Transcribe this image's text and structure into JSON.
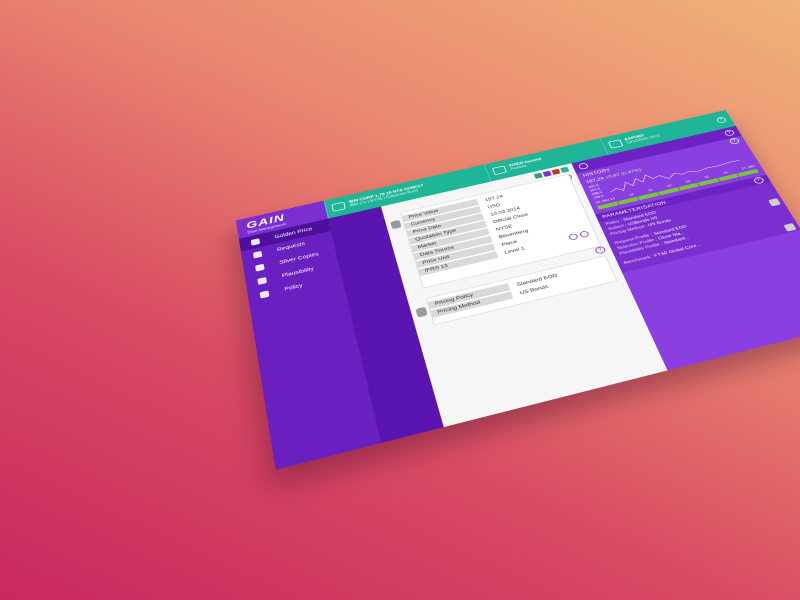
{
  "app": {
    "logo": "GAIN",
    "subtitle": "Data Management"
  },
  "topbar": {
    "instrument": {
      "title": "IBM CORP 1.75 18 NTS 02/06/17",
      "sub": "IBM 17s  |  NYSE  |  Corporate Bond"
    },
    "portfolio": {
      "title": "FIXED Income",
      "sub": "Portfolio"
    },
    "export": {
      "title": "EXPORT",
      "sub": "12/10/2015    18:02"
    }
  },
  "sidebar": {
    "items": [
      {
        "label": "Golden Price",
        "icon": "money-bag-icon",
        "active": true
      },
      {
        "label": "Requests",
        "icon": "people-icon"
      },
      {
        "label": "Silver Copies",
        "icon": "tag-icon"
      },
      {
        "label": "Plausibility",
        "icon": "grid-icon"
      },
      {
        "label": "Policy",
        "icon": "award-icon"
      }
    ]
  },
  "price_card": {
    "rows": [
      {
        "label": "Price Value",
        "value": "187,24"
      },
      {
        "label": "Currency",
        "value": "USD"
      },
      {
        "label": "Price Date",
        "value": "10.03.2014"
      },
      {
        "label": "Quotation Type",
        "value": "Official Close"
      },
      {
        "label": "Market",
        "value": "NYSE"
      },
      {
        "label": "Data Source",
        "value": "Bloomberg"
      },
      {
        "label": "Price Unit",
        "value": "Piece"
      },
      {
        "label": "IFRS 13",
        "value": "Level 1"
      }
    ]
  },
  "policy_card": {
    "rows": [
      {
        "label": "Pricing Policy",
        "value": "Standard EOD"
      },
      {
        "label": "Pricing Method",
        "value": "US Bonds"
      }
    ]
  },
  "history": {
    "title": "HISTORY",
    "value": "187,24",
    "change": "+0,87 (0,47%)",
    "ylabels": [
      "187,5",
      "187,0",
      "186,5",
      "186,0"
    ],
    "xlabels": [
      "10. Mrz 14",
      "11",
      "12",
      "13",
      "14",
      "15",
      "16",
      "17. Mrz"
    ]
  },
  "parameterisation": {
    "title": "PARAMETERISATION",
    "lines": [
      {
        "k": "Policy",
        "v": "Standard EOD"
      },
      {
        "k": "Subset",
        "v": "USBonds SS"
      },
      {
        "k": "Pricing Method",
        "v": "US Bonds"
      },
      {
        "k": "Request Profile",
        "v": "Standard EOD"
      },
      {
        "k": "Selection Profile",
        "v": "Close Sta..."
      },
      {
        "k": "Plausibility Profile",
        "v": "Standard..."
      },
      {
        "k": "Benchmark",
        "v": "FTSE Global Core..."
      }
    ]
  },
  "colors": {
    "purple": "#7b2fd0",
    "teal": "#1fb597",
    "deep_purple": "#5a14b0",
    "green": "#79c63d"
  }
}
